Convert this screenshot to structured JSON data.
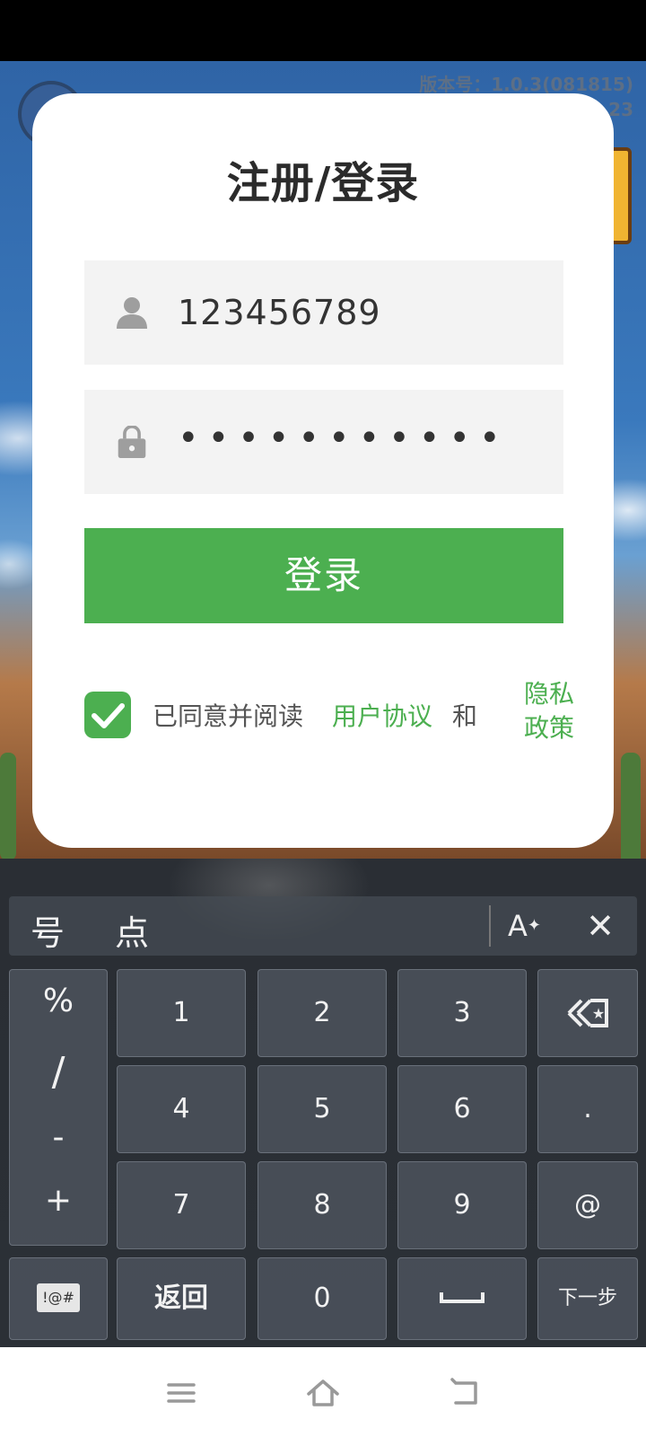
{
  "game": {
    "version_line1": "版本号：1.0.3(081815)",
    "version_line2": "23"
  },
  "dialog": {
    "title": "注册/登录",
    "username": {
      "icon": "person-icon",
      "value": "123456789"
    },
    "password": {
      "icon": "lock-icon",
      "value": "•••••••••••"
    },
    "login_label": "登录",
    "agreement": {
      "checked": true,
      "prefix": "已同意并阅读",
      "link_user_agreement": "用户协议",
      "and": "和",
      "link_privacy": "隐私政策"
    }
  },
  "keyboard": {
    "candidates": [
      "号",
      "点"
    ],
    "ai_label": "A",
    "symbols": [
      "%",
      "/",
      "-",
      "+"
    ],
    "keys": {
      "k1": "1",
      "k2": "2",
      "k3": "3",
      "k4": "4",
      "k5": "5",
      "k6": "6",
      "k7": "7",
      "k8": "8",
      "k9": "9",
      "k0": "0",
      "dot": ".",
      "at": "@",
      "symbols_switch": "!@#",
      "back": "返回",
      "next": "下一步"
    }
  },
  "navigation": {
    "icons": [
      "menu-icon",
      "home-icon",
      "back-icon"
    ]
  },
  "colors": {
    "accent": "#4caf50",
    "field_bg": "#f3f3f3"
  }
}
